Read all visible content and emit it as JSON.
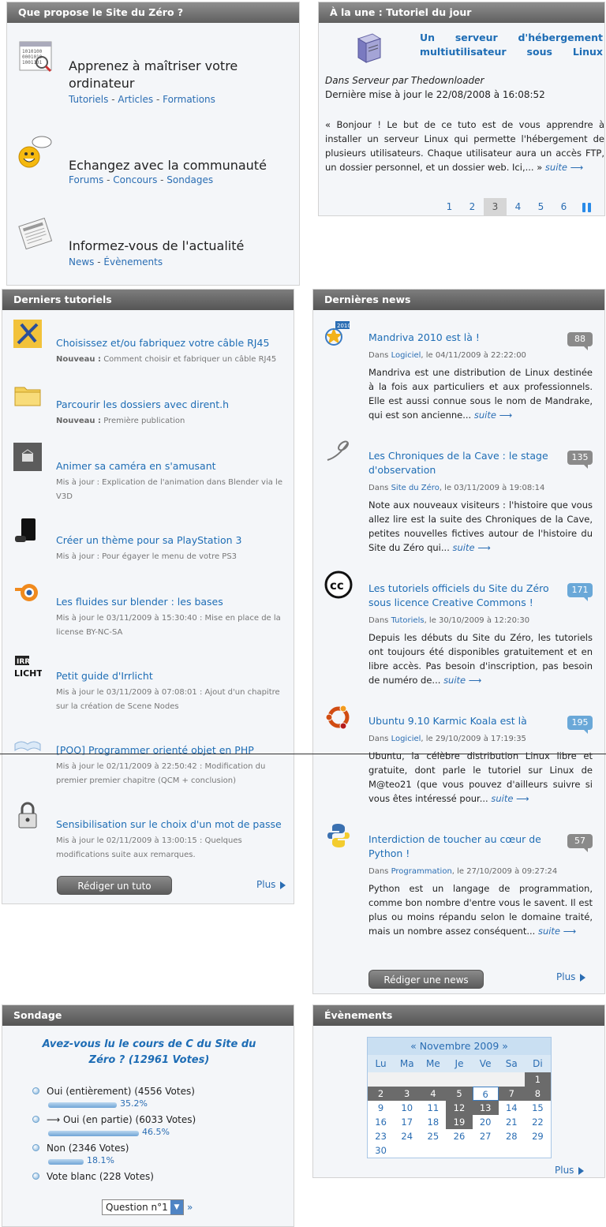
{
  "intro": {
    "header": "Que propose le Site du Zéro ?",
    "items": [
      {
        "title": "Apprenez à maîtriser votre ordinateur",
        "links": [
          "Tutoriels",
          "Articles",
          "Formations"
        ]
      },
      {
        "title": "Echangez avec la communauté",
        "links": [
          "Forums",
          "Concours",
          "Sondages"
        ]
      },
      {
        "title": "Informez-vous de l'actualité",
        "links": [
          "News",
          "Évènements"
        ]
      }
    ]
  },
  "tod": {
    "header": "À la une : Tutoriel du jour",
    "title": "Un serveur d'hébergement multiutilisateur sous Linux",
    "byline": "Dans Serveur par Thedownloader",
    "updated": "Dernière mise à jour le 22/08/2008 à 16:08:52",
    "text": "« Bonjour ! Le but de ce tuto est de vous apprendre à installer un serveur Linux qui permette l'hébergement de plusieurs utilisateurs. Chaque utilisateur aura un accès FTP, un dossier personnel, et un dossier web. Ici,... »",
    "more": "suite ⟶",
    "pages": [
      "1",
      "2",
      "3",
      "4",
      "5",
      "6"
    ],
    "current_page": "3"
  },
  "tutorials": {
    "header": "Derniers tutoriels",
    "items": [
      {
        "title": "Choisissez et/ou fabriquez votre câble RJ45",
        "kind": "Nouveau :",
        "sub": "Comment choisir et fabriquer un câble RJ45",
        "icon": "cable-icon"
      },
      {
        "title": "Parcourir les dossiers avec dirent.h",
        "kind": "Nouveau :",
        "sub": "Première publication",
        "icon": "folder-icon"
      },
      {
        "title": "Animer sa caméra en s'amusant",
        "kind": "",
        "sub": "Mis à jour : Explication de l'animation dans Blender via le V3D",
        "icon": "camera-icon"
      },
      {
        "title": "Créer un thème pour sa PlayStation 3",
        "kind": "",
        "sub": "Mis à jour : Pour égayer le menu de votre PS3",
        "icon": "playstation-icon"
      },
      {
        "title": "Les fluides sur blender : les bases",
        "kind": "",
        "sub": "Mis à jour le 03/11/2009 à 15:30:40 : Mise en place de la license BY-NC-SA",
        "icon": "blender-icon"
      },
      {
        "title": "Petit guide d'Irrlicht",
        "kind": "",
        "sub": "Mis à jour le 03/11/2009 à 07:08:01 : Ajout d'un chapitre sur la création de Scene Nodes",
        "icon": "irrlicht-icon"
      },
      {
        "title": "[POO] Programmer orienté objet en PHP",
        "kind": "",
        "sub": "Mis à jour le 02/11/2009 à 22:50:42 : Modification du premier premier chapitre (QCM + conclusion)",
        "icon": "book-icon"
      },
      {
        "title": "Sensibilisation sur le choix d'un mot de passe",
        "kind": "",
        "sub": "Mis à jour le 02/11/2009 à 13:00:15 : Quelques modifications suite aux remarques.",
        "icon": "padlock-icon"
      }
    ],
    "write_button": "Rédiger un tuto",
    "more": "Plus"
  },
  "news": {
    "header": "Dernières news",
    "items": [
      {
        "title": "Mandriva 2010 est là !",
        "count": "88",
        "cat": "Logiciel",
        "date": ", le 04/11/2009 à 22:22:00",
        "text": "Mandriva est une distribution de Linux destinée à la fois aux particuliers et aux professionnels. Elle est aussi connue sous le nom de Mandrake, qui est son ancienne...",
        "more": "suite ⟶",
        "icon": "mandriva-icon"
      },
      {
        "title": "Les Chroniques de la Cave : le stage d'observation",
        "count": "135",
        "cat": "Site du Zéro",
        "date": ", le 03/11/2009 à 19:08:14",
        "text": "Note aux nouveaux visiteurs : l'histoire que vous allez lire est la suite des Chroniques de la Cave, petites nouvelles fictives autour de l'histoire du Site du Zéro qui...",
        "more": "suite ⟶",
        "icon": "chronicle-icon"
      },
      {
        "title": "Les tutoriels officiels du Site du Zéro sous licence Creative Commons !",
        "count": "171",
        "cat": "Tutoriels",
        "date": ", le 30/10/2009 à 12:20:30",
        "text": "Depuis les débuts du Site du Zéro, les tutoriels ont toujours été disponibles gratuitement et en libre accès. Pas besoin d'inscription, pas besoin de numéro de...",
        "more": "suite ⟶",
        "icon": "creative-commons-icon"
      },
      {
        "title": "Ubuntu 9.10 Karmic Koala est là",
        "count": "195",
        "cat": "Logiciel",
        "date": ", le 29/10/2009 à 17:19:35",
        "text": "Ubuntu, la célèbre distribution Linux libre et gratuite, dont parle le tutoriel sur Linux de M@teo21 (que vous pouvez d'ailleurs suivre si vous êtes intéressé pour...",
        "more": "suite ⟶",
        "icon": "ubuntu-icon"
      },
      {
        "title": "Interdiction de toucher au cœur de Python !",
        "count": "57",
        "cat": "Programmation",
        "date": ", le 27/10/2009 à 09:27:24",
        "text": "Python est un langage de programmation, comme bon nombre d'entre vous le savent. Il est plus ou moins répandu selon le domaine traité, mais un nombre assez conséquent...",
        "more": "suite ⟶",
        "icon": "python-icon"
      }
    ],
    "prefix": "Dans ",
    "write_button": "Rédiger une news",
    "more": "Plus"
  },
  "poll": {
    "header": "Sondage",
    "question": "Avez-vous lu le cours de C du Site du Zéro ? (12961 Votes)",
    "options": [
      {
        "label": "Oui (entièrement) (4556 Votes)",
        "pct": "35.2%",
        "value": 35.2
      },
      {
        "label": "⟶ Oui (en partie) (6033 Votes)",
        "pct": "46.5%",
        "value": 46.5
      },
      {
        "label": "Non (2346 Votes)",
        "pct": "18.1%",
        "value": 18.1
      },
      {
        "label": "Vote blanc (228 Votes)",
        "pct": "",
        "value": 0
      }
    ],
    "select_value": "Question n°1",
    "next": "»"
  },
  "events": {
    "header": "Évènements",
    "month": "« Novembre 2009 »",
    "days": [
      "Lu",
      "Ma",
      "Me",
      "Je",
      "Ve",
      "Sa",
      "Di"
    ],
    "more": "Plus"
  }
}
